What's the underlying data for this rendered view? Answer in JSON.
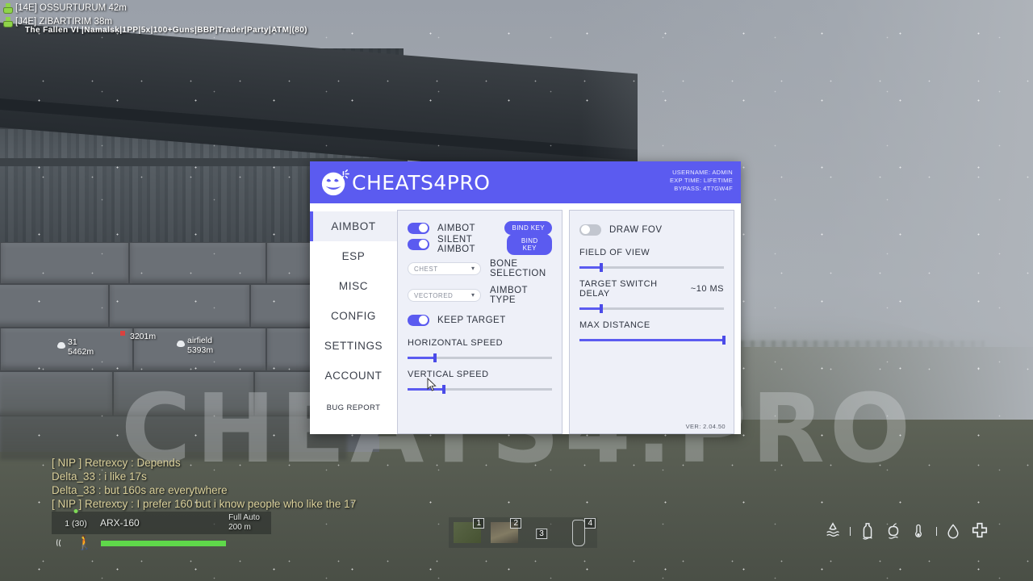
{
  "game_hud": {
    "esp_players": [
      {
        "tag": "[14E]",
        "name": "OSSURTURUM",
        "distance": "42m"
      },
      {
        "tag": "[J4E]",
        "name": "ZIBARTIRIM",
        "distance": "38m"
      }
    ],
    "server_name": "The Fallen VI |Namalsk|1PP|5x|100+Guns|BBP|Trader|Party|ATM|(80)",
    "world_markers": [
      {
        "label": "31",
        "distance": "5462m"
      },
      {
        "label": "",
        "distance": "3201m"
      },
      {
        "label": "airfield",
        "distance": "5393m"
      }
    ],
    "chat": [
      "[ NIP ] Retrexcy : Depends",
      "Delta_33 : i like 17s",
      "Delta_33 : but 160s are everytwhere",
      "[ NIP ] Retrexcy : I prefer 160 but i know people who like the 17"
    ],
    "weapon": {
      "ammo": "1 (30)",
      "name": "ARX-160",
      "fire_mode": "Full Auto",
      "zero_range": "200 m"
    },
    "hotbar": [
      {
        "slot": "1",
        "icon": "bush-item-icon"
      },
      {
        "slot": "2",
        "icon": "rifle-item-icon"
      },
      {
        "slot": "3",
        "icon": "empty-slot-icon"
      },
      {
        "slot": "4",
        "icon": "bottle-item-icon"
      }
    ],
    "status_icons": [
      "wetness-icon",
      "thirst-bottle-icon",
      "hunger-apple-icon",
      "temperature-icon",
      "blood-drop-icon",
      "health-cross-icon"
    ],
    "watermark_text": "CHEATS4.PRO"
  },
  "menu": {
    "brand": "CHEATS4PRO",
    "account": {
      "username": "USERNAME: ADMIN",
      "exp_time": "EXP TIME: LIFETIME",
      "bypass": "BYPASS: 4T7GW4F"
    },
    "version": "VER: 2.04.50",
    "accent_color": "#5b5bf0",
    "sidebar": {
      "items": [
        {
          "label": "AIMBOT",
          "active": true
        },
        {
          "label": "ESP",
          "active": false
        },
        {
          "label": "MISC",
          "active": false
        },
        {
          "label": "CONFIG",
          "active": false
        },
        {
          "label": "SETTINGS",
          "active": false
        },
        {
          "label": "ACCOUNT",
          "active": false
        }
      ],
      "bug_report": "BUG REPORT"
    },
    "left_panel": {
      "aimbot_toggle": {
        "label": "AIMBOT",
        "on": true,
        "bind_label": "BIND KEY"
      },
      "silent_aimbot_toggle": {
        "label": "SILENT AIMBOT",
        "on": true,
        "bind_label": "BIND KEY"
      },
      "bone_selection": {
        "label": "BONE SELECTION",
        "value": "CHEST"
      },
      "aimbot_type": {
        "label": "AIMBOT TYPE",
        "value": "VECTORED"
      },
      "keep_target": {
        "label": "KEEP TARGET",
        "on": true
      },
      "horizontal_speed": {
        "label": "HORIZONTAL SPEED",
        "percent": 19
      },
      "vertical_speed": {
        "label": "VERTICAL SPEED",
        "percent": 25
      }
    },
    "right_panel": {
      "draw_fov": {
        "label": "DRAW FOV",
        "on": false
      },
      "field_of_view": {
        "label": "FIELD OF VIEW",
        "percent": 15
      },
      "target_switch_delay": {
        "label": "TARGET SWITCH DELAY",
        "value": "~10 MS",
        "percent": 15
      },
      "max_distance": {
        "label": "MAX DISTANCE",
        "percent": 100
      }
    }
  }
}
